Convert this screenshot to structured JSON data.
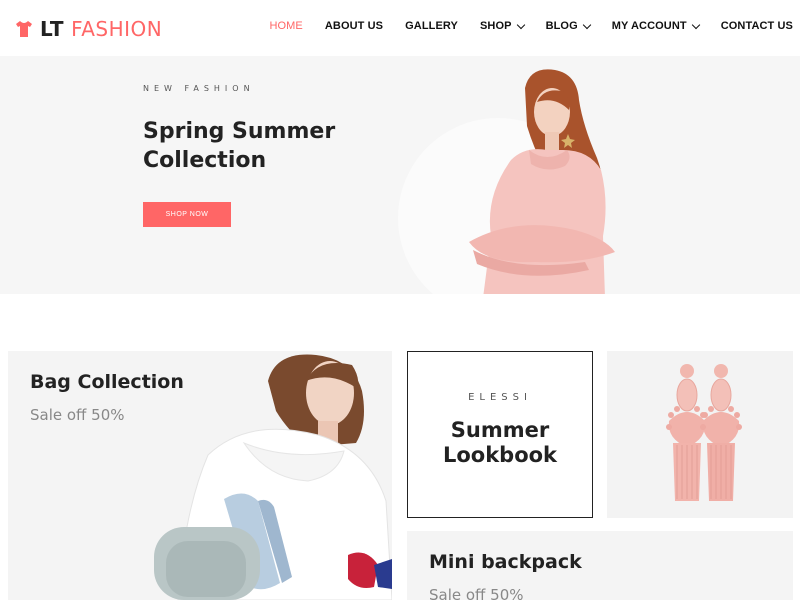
{
  "brand": {
    "prefix": "LT",
    "name": "FASHION",
    "accent": "#ff6666",
    "icon": "tshirt-icon"
  },
  "nav": {
    "items": [
      {
        "label": "HOME",
        "active": true,
        "dropdown": false
      },
      {
        "label": "ABOUT US",
        "active": false,
        "dropdown": false
      },
      {
        "label": "GALLERY",
        "active": false,
        "dropdown": false
      },
      {
        "label": "SHOP",
        "active": false,
        "dropdown": true
      },
      {
        "label": "BLOG",
        "active": false,
        "dropdown": true
      },
      {
        "label": "MY ACCOUNT",
        "active": false,
        "dropdown": true
      },
      {
        "label": "CONTACT US",
        "active": false,
        "dropdown": false
      }
    ]
  },
  "hero": {
    "kicker": "NEW FASHION",
    "title": "Spring Summer Collection",
    "button_label": "SHOP NOW",
    "button_color": "#ff6666",
    "background": "#f6f6f6"
  },
  "tiles": {
    "bag": {
      "title": "Bag Collection",
      "subtitle": "Sale off 50%"
    },
    "lookbook": {
      "kicker": "ELESSI",
      "title": "Summer Lookbook"
    },
    "earring": {
      "image": "pink-tassel-earrings"
    },
    "backpack": {
      "title": "Mini backpack",
      "subtitle": "Sale off 50%"
    }
  }
}
